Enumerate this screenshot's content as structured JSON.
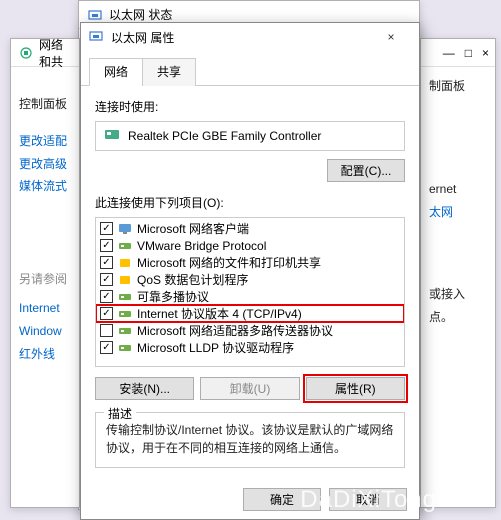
{
  "bg1": {
    "title": "以太网 状态"
  },
  "bg2": {
    "title": "网络和共",
    "lines": [
      "控制面板",
      "更改适配",
      "更改高级",
      "媒体流式"
    ],
    "links_label": "另请参阅",
    "links": [
      "Internet",
      "Window",
      "红外线"
    ]
  },
  "bg3": {
    "ctrl": "制面板",
    "lines": [
      "ernet",
      "太网",
      "或接入点。"
    ],
    "winctrl": {
      "min": "—",
      "max": "□",
      "close": "×"
    }
  },
  "dialog": {
    "title": "以太网 属性",
    "close": "×",
    "tabs": [
      {
        "label": "网络",
        "active": true
      },
      {
        "label": "共享",
        "active": false
      }
    ],
    "connect_label": "连接时使用:",
    "adapter": "Realtek PCIe GBE Family Controller",
    "configure_btn": "配置(C)...",
    "items_label": "此连接使用下列项目(O):",
    "items": [
      {
        "checked": true,
        "icon": "client",
        "label": "Microsoft 网络客户端"
      },
      {
        "checked": true,
        "icon": "proto",
        "label": "VMware Bridge Protocol"
      },
      {
        "checked": true,
        "icon": "service",
        "label": "Microsoft 网络的文件和打印机共享"
      },
      {
        "checked": true,
        "icon": "service",
        "label": "QoS 数据包计划程序"
      },
      {
        "checked": true,
        "icon": "proto",
        "label": "可靠多播协议"
      },
      {
        "checked": true,
        "icon": "proto",
        "label": "Internet 协议版本 4 (TCP/IPv4)",
        "hl": true
      },
      {
        "checked": false,
        "icon": "proto",
        "label": "Microsoft 网络适配器多路传送器协议"
      },
      {
        "checked": true,
        "icon": "proto",
        "label": "Microsoft LLDP 协议驱动程序"
      }
    ],
    "btns": {
      "install": "安装(N)...",
      "uninstall": "卸载(U)",
      "properties": "属性(R)"
    },
    "desc_title": "描述",
    "desc_text": "传输控制协议/Internet 协议。该协议是默认的广域网络协议，用于在不同的相互连接的网络上通信。",
    "ok": "确定",
    "cancel": "取消"
  },
  "watermark": "DaDiXiTong.com"
}
